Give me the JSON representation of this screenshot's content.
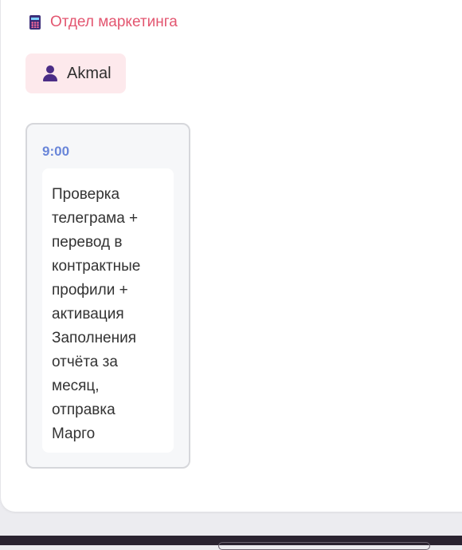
{
  "department": {
    "icon": "abacus-icon",
    "label": "Отдел маркетинга",
    "color": "#e35670"
  },
  "user": {
    "icon": "user-icon",
    "name": "Akmal"
  },
  "schedule": {
    "entries": [
      {
        "time": "9:00",
        "text": "Проверка\nтелеграма +\nперевод в\nконтрактные\nпрофили +\nактивация\nЗаполнения\nотчёта за\nмесяц,\nотправка\nМарго"
      }
    ]
  }
}
